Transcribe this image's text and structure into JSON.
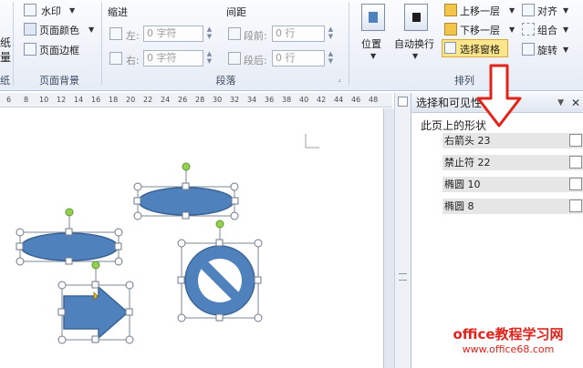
{
  "ribbon": {
    "left_stub_top": "纸",
    "left_stub_bottom": "量",
    "left_stub_group": "纸",
    "page_background": {
      "watermark": "水印",
      "page_color": "页面颜色",
      "page_border": "页面边框",
      "group_label": "页面背景"
    },
    "paragraph": {
      "indent_label": "缩进",
      "spacing_label": "间距",
      "left_label": "左:",
      "right_label": "右:",
      "before_label": "段前:",
      "after_label": "段后:",
      "left_value": "0 字符",
      "right_value": "0 字符",
      "before_value": "0 行",
      "after_value": "0 行",
      "group_label": "段落"
    },
    "arrange": {
      "position": "位置",
      "wrap_text": "自动换行",
      "bring_forward": "上移一层",
      "send_backward": "下移一层",
      "selection_pane": "选择窗格",
      "align": "对齐",
      "group": "组合",
      "rotate": "旋转",
      "group_label": "排列"
    }
  },
  "ruler": {
    "ticks": [
      "6",
      "8",
      "10",
      "12",
      "14",
      "16",
      "18",
      "20",
      "22",
      "24",
      "26",
      "28",
      "30",
      "32",
      "34",
      "36",
      "38",
      "40",
      "42",
      "44",
      "46",
      "48"
    ]
  },
  "pane": {
    "title": "选择和可见性",
    "close": "✕",
    "section": "此页上的形状",
    "shapes": [
      {
        "name": "右箭头 23"
      },
      {
        "name": "禁止符 22"
      },
      {
        "name": "椭圆 10"
      },
      {
        "name": "椭圆 8"
      }
    ]
  },
  "watermark": {
    "line1": "office教程学习网",
    "line2": "www.office68.com"
  },
  "colors": {
    "shape_fill": "#4f81bd",
    "shape_stroke": "#3b6496",
    "highlight": "#fde68a",
    "annotation_arrow": "#e2231a",
    "watermark_red": "#e2231a"
  }
}
